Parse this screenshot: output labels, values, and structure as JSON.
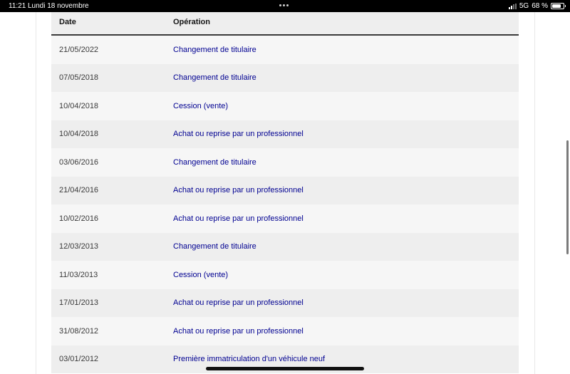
{
  "status_bar": {
    "time": "11:21",
    "date": "Lundi 18 novembre",
    "network": "5G",
    "battery": "68 %"
  },
  "table": {
    "headers": {
      "date": "Date",
      "operation": "Opération"
    },
    "rows": [
      {
        "date": "21/05/2022",
        "operation": "Changement de titulaire"
      },
      {
        "date": "07/05/2018",
        "operation": "Changement de titulaire"
      },
      {
        "date": "10/04/2018",
        "operation": "Cession (vente)"
      },
      {
        "date": "10/04/2018",
        "operation": "Achat ou reprise par un professionnel"
      },
      {
        "date": "03/06/2016",
        "operation": "Changement de titulaire"
      },
      {
        "date": "21/04/2016",
        "operation": "Achat ou reprise par un professionnel"
      },
      {
        "date": "10/02/2016",
        "operation": "Achat ou reprise par un professionnel"
      },
      {
        "date": "12/03/2013",
        "operation": "Changement de titulaire"
      },
      {
        "date": "11/03/2013",
        "operation": "Cession (vente)"
      },
      {
        "date": "17/01/2013",
        "operation": "Achat ou reprise par un professionnel"
      },
      {
        "date": "31/08/2012",
        "operation": "Achat ou reprise par un professionnel"
      },
      {
        "date": "03/01/2012",
        "operation": "Première immatriculation d'un véhicule neuf"
      }
    ]
  },
  "colors": {
    "link": "#000091",
    "row_light": "#f6f6f6",
    "row_dark": "#eeeeee",
    "header_border": "#3a3a3a"
  },
  "icons": [
    "signal-icon",
    "battery-icon",
    "multitasking-dots-icon"
  ]
}
